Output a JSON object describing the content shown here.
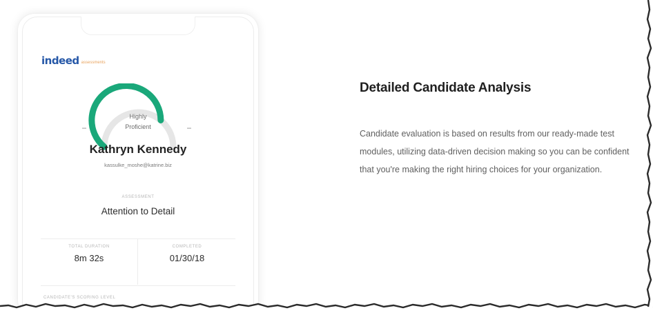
{
  "profile_card": {
    "logo": {
      "word": "indeed",
      "suffix": "assessments"
    },
    "gauge": {
      "label_line1": "Highly",
      "label_line2": "Proficient",
      "level": 0.72,
      "fill_color": "#1aa87a",
      "track_color": "#e6e6e6"
    },
    "candidate_name": "Kathryn Kennedy",
    "candidate_email": "kassulke_moshe@katrine.biz",
    "assessment_label": "ASSESSMENT",
    "assessment_value": "Attention to Detail",
    "total_duration_label": "TOTAL DURATION",
    "total_duration_value": "8m 32s",
    "completed_label": "COMPLETED",
    "completed_value": "01/30/18",
    "scoring_label": "CANDIDATE'S SCORING LEVEL"
  },
  "feature": {
    "heading": "Detailed Candidate Analysis",
    "body": "Candidate evaluation is based on results from our ready-made test modules, utilizing data-driven decision making so you can be confident that you're making the right hiring choices for your organization."
  },
  "colors": {
    "logo_blue": "#2557a7",
    "logo_orange": "#e8a25c",
    "gauge_green": "#1aa87a"
  }
}
